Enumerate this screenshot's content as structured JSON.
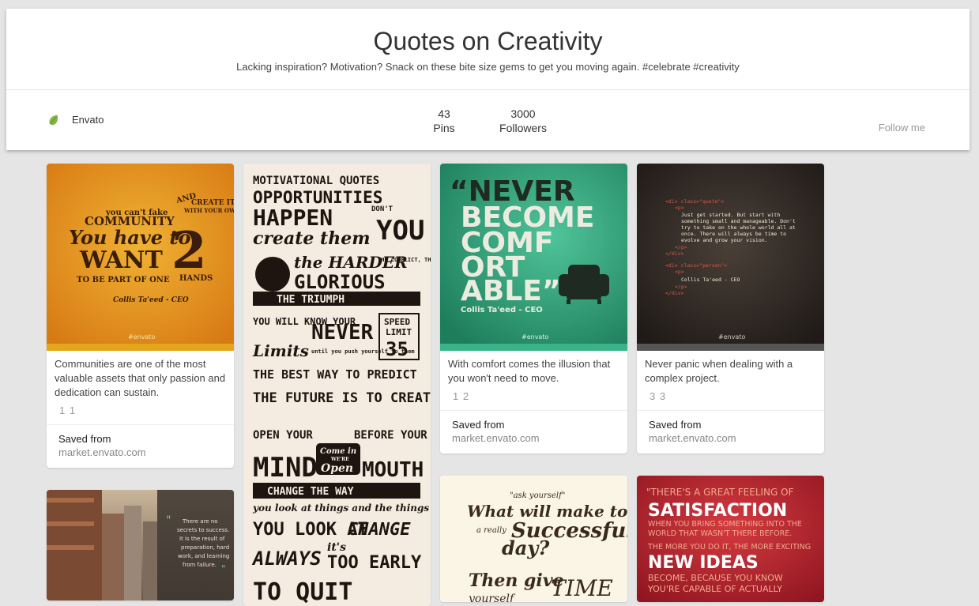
{
  "board": {
    "title": "Quotes on Creativity",
    "description": "Lacking inspiration? Motivation? Snack on these bite size gems to get you moving again. #celebrate #creativity",
    "owner": "Envato",
    "pins_count": "43",
    "pins_label": "Pins",
    "followers_count": "3000",
    "followers_label": "Followers",
    "follow_label": "Follow me"
  },
  "colors": {
    "background": "#e5e5e5",
    "envato_green": "#82b541",
    "orange_card": "#e2931c",
    "green_card": "#2f9e76",
    "dark_card": "#2b2623",
    "red_card": "#b3212b"
  },
  "pins": [
    {
      "image_text": {
        "line1": "you can't fake",
        "line2": "COMMUNITY",
        "line3": "You have to",
        "line4": "WANT",
        "line5": "TO BE PART OF ONE",
        "and": "AND",
        "create": "CREATE IT",
        "with": "WITH YOUR OWN",
        "number": "2",
        "hands": "HANDS",
        "author": "Collis Ta'eed - CEO",
        "brand": "#envato"
      },
      "description": "Communities are one of the most valuable assets that only passion and dedication can sustain.",
      "counts": "1 1",
      "saved_label": "Saved from",
      "source": "market.envato.com"
    },
    {
      "image_text": {
        "l1": "MOTIVATIONAL QUOTES",
        "l2": "OPPORTUNITIES",
        "l3": "HAPPEN",
        "dont": "DON'T",
        "you": "YOU",
        "l4": "create them",
        "l5": "the HARDER",
        "l5b": "THE CONFLICT, THE MORE",
        "l6": "GLORIOUS",
        "l7": "THE TRIUMPH",
        "l8": "YOU WILL KNOW YOUR",
        "never": "NEVER",
        "speed": "SPEED",
        "limit": "LIMIT",
        "num": "35",
        "limits": "Limits",
        "until": "until you push yourself to them",
        "l9": "THE BEST WAY TO PREDICT",
        "l10": "THE FUTURE IS TO CREATE IT",
        "l11": "OPEN YOUR",
        "l11b": "BEFORE YOUR",
        "mind": "MIND",
        "mouth": "MOUTH",
        "comein": "Come in",
        "were": "WE'RE",
        "open": "Open",
        "l12": "CHANGE THE WAY",
        "l13": "you look at things and the things",
        "l14": "YOU LOOK AT",
        "change": "CHANGE",
        "l15": "ALWAYS",
        "its": "it's",
        "early": "TOO EARLY",
        "quit": "TO QUIT"
      }
    },
    {
      "image_text": {
        "l1": "“NEVER",
        "l2": "BECOME",
        "l3": "COMF",
        "l4": "ORT",
        "l5": "ABLE”",
        "author": "Collis Ta'eed - CEO",
        "brand": "#envato"
      },
      "description": "With comfort comes the illusion that you won't need to move.",
      "counts": "1 2",
      "saved_label": "Saved from",
      "source": "market.envato.com"
    },
    {
      "image_text": {
        "c1": "<div class=\"quote\">",
        "c2": "<p>",
        "c3": "Just get started. But start with",
        "c4": "something small and manageable. Don't",
        "c5": "try to take on the whole world all at",
        "c6": "once. There will always be time to",
        "c7": "evolve and grow your vision.",
        "c8": "</p>",
        "c9": "</div>",
        "c10": "<div class=\"person\">",
        "c11": "<p>",
        "c12": "Collis Ta'eed - CEO",
        "c13": "</p>",
        "c14": "</div>",
        "brand": "#envato"
      },
      "description": "Never panic when dealing with a complex project.",
      "counts": "3 3",
      "saved_label": "Saved from",
      "source": "market.envato.com"
    },
    {
      "image_text": {
        "q1": "There are no",
        "q2": "secrets to success.",
        "q3": "It is the result of",
        "q4": "preparation, hard",
        "q5": "work, and learning",
        "q6": "from failure."
      }
    },
    {
      "image_text": {
        "l1": "\"ask yourself\"",
        "l2": "What will make today",
        "l3": "a really",
        "l4": "Successful",
        "l5": "day?",
        "l6": "Then give",
        "l7": "yourself",
        "l8": "TIME"
      }
    },
    {
      "image_text": {
        "l1": "\"THERE'S A GREAT FEELING OF",
        "l2": "SATISFACTION",
        "l3": "WHEN YOU BRING SOMETHING INTO THE",
        "l4": "WORLD THAT WASN'T THERE BEFORE.",
        "l5": "THE MORE YOU DO IT, THE MORE EXCITING",
        "l6": "NEW IDEAS",
        "l7": "BECOME, BECAUSE YOU KNOW",
        "l8": "YOU'RE CAPABLE OF ACTUALLY"
      }
    }
  ]
}
